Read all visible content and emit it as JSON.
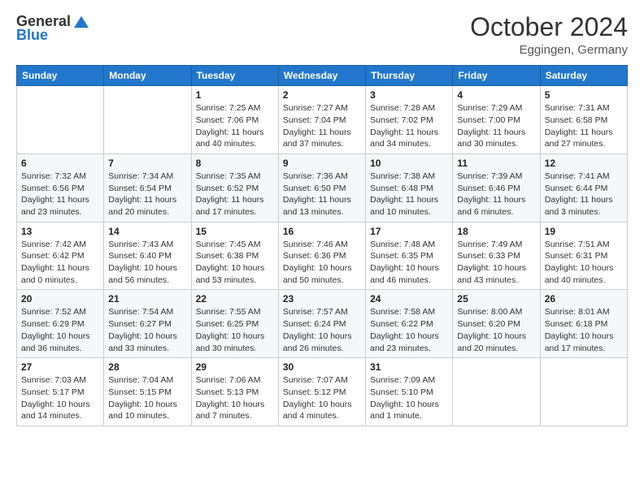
{
  "header": {
    "logo_general": "General",
    "logo_blue": "Blue",
    "title": "October 2024",
    "subtitle": "Eggingen, Germany"
  },
  "days_of_week": [
    "Sunday",
    "Monday",
    "Tuesday",
    "Wednesday",
    "Thursday",
    "Friday",
    "Saturday"
  ],
  "weeks": [
    [
      {
        "day": "",
        "info": ""
      },
      {
        "day": "",
        "info": ""
      },
      {
        "day": "1",
        "sunrise": "7:25 AM",
        "sunset": "7:06 PM",
        "daylight": "11 hours and 40 minutes."
      },
      {
        "day": "2",
        "sunrise": "7:27 AM",
        "sunset": "7:04 PM",
        "daylight": "11 hours and 37 minutes."
      },
      {
        "day": "3",
        "sunrise": "7:28 AM",
        "sunset": "7:02 PM",
        "daylight": "11 hours and 34 minutes."
      },
      {
        "day": "4",
        "sunrise": "7:29 AM",
        "sunset": "7:00 PM",
        "daylight": "11 hours and 30 minutes."
      },
      {
        "day": "5",
        "sunrise": "7:31 AM",
        "sunset": "6:58 PM",
        "daylight": "11 hours and 27 minutes."
      }
    ],
    [
      {
        "day": "6",
        "sunrise": "7:32 AM",
        "sunset": "6:56 PM",
        "daylight": "11 hours and 23 minutes."
      },
      {
        "day": "7",
        "sunrise": "7:34 AM",
        "sunset": "6:54 PM",
        "daylight": "11 hours and 20 minutes."
      },
      {
        "day": "8",
        "sunrise": "7:35 AM",
        "sunset": "6:52 PM",
        "daylight": "11 hours and 17 minutes."
      },
      {
        "day": "9",
        "sunrise": "7:36 AM",
        "sunset": "6:50 PM",
        "daylight": "11 hours and 13 minutes."
      },
      {
        "day": "10",
        "sunrise": "7:38 AM",
        "sunset": "6:48 PM",
        "daylight": "11 hours and 10 minutes."
      },
      {
        "day": "11",
        "sunrise": "7:39 AM",
        "sunset": "6:46 PM",
        "daylight": "11 hours and 6 minutes."
      },
      {
        "day": "12",
        "sunrise": "7:41 AM",
        "sunset": "6:44 PM",
        "daylight": "11 hours and 3 minutes."
      }
    ],
    [
      {
        "day": "13",
        "sunrise": "7:42 AM",
        "sunset": "6:42 PM",
        "daylight": "11 hours and 0 minutes."
      },
      {
        "day": "14",
        "sunrise": "7:43 AM",
        "sunset": "6:40 PM",
        "daylight": "10 hours and 56 minutes."
      },
      {
        "day": "15",
        "sunrise": "7:45 AM",
        "sunset": "6:38 PM",
        "daylight": "10 hours and 53 minutes."
      },
      {
        "day": "16",
        "sunrise": "7:46 AM",
        "sunset": "6:36 PM",
        "daylight": "10 hours and 50 minutes."
      },
      {
        "day": "17",
        "sunrise": "7:48 AM",
        "sunset": "6:35 PM",
        "daylight": "10 hours and 46 minutes."
      },
      {
        "day": "18",
        "sunrise": "7:49 AM",
        "sunset": "6:33 PM",
        "daylight": "10 hours and 43 minutes."
      },
      {
        "day": "19",
        "sunrise": "7:51 AM",
        "sunset": "6:31 PM",
        "daylight": "10 hours and 40 minutes."
      }
    ],
    [
      {
        "day": "20",
        "sunrise": "7:52 AM",
        "sunset": "6:29 PM",
        "daylight": "10 hours and 36 minutes."
      },
      {
        "day": "21",
        "sunrise": "7:54 AM",
        "sunset": "6:27 PM",
        "daylight": "10 hours and 33 minutes."
      },
      {
        "day": "22",
        "sunrise": "7:55 AM",
        "sunset": "6:25 PM",
        "daylight": "10 hours and 30 minutes."
      },
      {
        "day": "23",
        "sunrise": "7:57 AM",
        "sunset": "6:24 PM",
        "daylight": "10 hours and 26 minutes."
      },
      {
        "day": "24",
        "sunrise": "7:58 AM",
        "sunset": "6:22 PM",
        "daylight": "10 hours and 23 minutes."
      },
      {
        "day": "25",
        "sunrise": "8:00 AM",
        "sunset": "6:20 PM",
        "daylight": "10 hours and 20 minutes."
      },
      {
        "day": "26",
        "sunrise": "8:01 AM",
        "sunset": "6:18 PM",
        "daylight": "10 hours and 17 minutes."
      }
    ],
    [
      {
        "day": "27",
        "sunrise": "7:03 AM",
        "sunset": "5:17 PM",
        "daylight": "10 hours and 14 minutes."
      },
      {
        "day": "28",
        "sunrise": "7:04 AM",
        "sunset": "5:15 PM",
        "daylight": "10 hours and 10 minutes."
      },
      {
        "day": "29",
        "sunrise": "7:06 AM",
        "sunset": "5:13 PM",
        "daylight": "10 hours and 7 minutes."
      },
      {
        "day": "30",
        "sunrise": "7:07 AM",
        "sunset": "5:12 PM",
        "daylight": "10 hours and 4 minutes."
      },
      {
        "day": "31",
        "sunrise": "7:09 AM",
        "sunset": "5:10 PM",
        "daylight": "10 hours and 1 minute."
      },
      {
        "day": "",
        "info": ""
      },
      {
        "day": "",
        "info": ""
      }
    ]
  ],
  "labels": {
    "sunrise": "Sunrise:",
    "sunset": "Sunset:",
    "daylight": "Daylight:"
  }
}
